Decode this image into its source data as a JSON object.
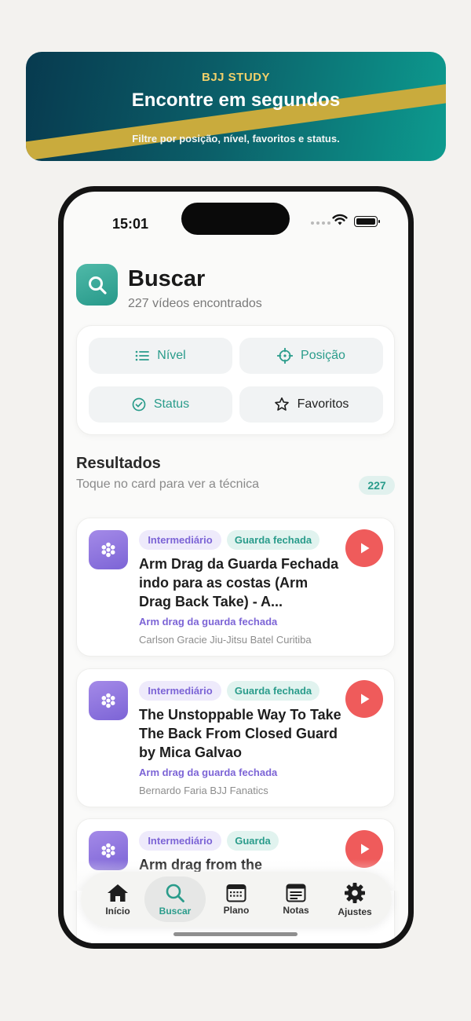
{
  "banner": {
    "eyebrow": "BJJ STUDY",
    "title": "Encontre em segundos",
    "subtitle": "Filtre por posição, nível, favoritos e status."
  },
  "status_bar": {
    "time": "15:01"
  },
  "header": {
    "icon": "search-icon",
    "title": "Buscar",
    "subtitle": "227 vídeos encontrados"
  },
  "filters": [
    {
      "label": "Nível",
      "icon": "list-icon"
    },
    {
      "label": "Posição",
      "icon": "crosshair-icon"
    },
    {
      "label": "Status",
      "icon": "check-circle-icon"
    },
    {
      "label": "Favoritos",
      "icon": "star-icon"
    }
  ],
  "results": {
    "title": "Resultados",
    "subtitle": "Toque no card para ver a técnica",
    "count": "227",
    "items": [
      {
        "level": "Intermediário",
        "position": "Guarda fechada",
        "title": "Arm Drag da Guarda Fechada indo para as costas (Arm Drag Back Take)  - A...",
        "technique": "Arm drag da guarda fechada",
        "channel": "Carlson Gracie Jiu-Jitsu Batel Curitiba"
      },
      {
        "level": "Intermediário",
        "position": "Guarda fechada",
        "title": "The Unstoppable Way To Take The Back From Closed Guard by Mica Galvao",
        "technique": "Arm drag da guarda fechada",
        "channel": "Bernardo Faria BJJ Fanatics"
      },
      {
        "level": "Intermediário",
        "position": "Guarda",
        "title": "Arm drag from the",
        "technique": "",
        "channel": ""
      }
    ]
  },
  "tabs": [
    {
      "label": "Início",
      "icon": "home-icon"
    },
    {
      "label": "Buscar",
      "icon": "search-icon",
      "active": true
    },
    {
      "label": "Plano",
      "icon": "calendar-icon"
    },
    {
      "label": "Notas",
      "icon": "notes-icon"
    },
    {
      "label": "Ajustes",
      "icon": "gear-icon"
    }
  ],
  "colors": {
    "accent": "#2a9c8b",
    "purple": "#7c64d6",
    "play": "#ef5b5b",
    "banner_gold": "#c9ab3d"
  }
}
